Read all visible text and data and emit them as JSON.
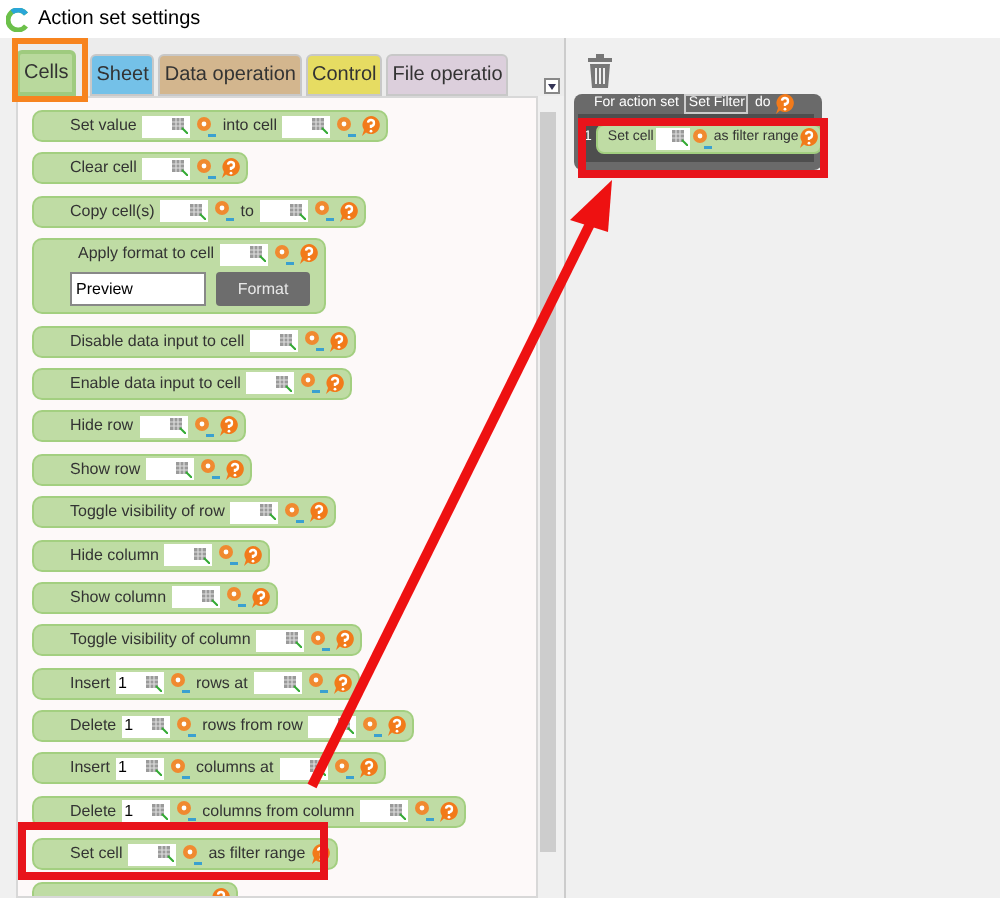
{
  "window": {
    "title": "Action set settings"
  },
  "tabs": [
    {
      "label": "Cells",
      "selected": true,
      "color": "#b9d99d"
    },
    {
      "label": "Sheet",
      "selected": false,
      "color": "#74c1e8"
    },
    {
      "label": "Data operation",
      "selected": false,
      "color": "#d3b68e"
    },
    {
      "label": "Control",
      "selected": false,
      "color": "#e6dc62"
    },
    {
      "label": "File operatio",
      "selected": false,
      "color": "#dccfdc"
    }
  ],
  "palette": [
    {
      "kind": "line",
      "parts": [
        {
          "kind": "text",
          "text": "Set value"
        },
        {
          "kind": "field"
        },
        {
          "kind": "text",
          "text": "into cell"
        },
        {
          "kind": "field"
        }
      ]
    },
    {
      "kind": "line",
      "parts": [
        {
          "kind": "text",
          "text": "Clear cell"
        },
        {
          "kind": "field"
        }
      ]
    },
    {
      "kind": "line",
      "parts": [
        {
          "kind": "text",
          "text": "Copy cell(s)"
        },
        {
          "kind": "field"
        },
        {
          "kind": "text",
          "text": "to"
        },
        {
          "kind": "field"
        }
      ]
    },
    {
      "kind": "format",
      "parts": [
        {
          "kind": "text",
          "text": "Apply format to cell"
        },
        {
          "kind": "field"
        }
      ],
      "preview": "Preview",
      "button": "Format"
    },
    {
      "kind": "line",
      "parts": [
        {
          "kind": "text",
          "text": "Disable data input to cell"
        },
        {
          "kind": "field"
        }
      ]
    },
    {
      "kind": "line",
      "parts": [
        {
          "kind": "text",
          "text": "Enable data input to cell"
        },
        {
          "kind": "field"
        }
      ]
    },
    {
      "kind": "line",
      "parts": [
        {
          "kind": "text",
          "text": "Hide row"
        },
        {
          "kind": "field"
        }
      ]
    },
    {
      "kind": "line",
      "parts": [
        {
          "kind": "text",
          "text": "Show row"
        },
        {
          "kind": "field"
        }
      ]
    },
    {
      "kind": "line",
      "parts": [
        {
          "kind": "text",
          "text": "Toggle visibility of row"
        },
        {
          "kind": "field"
        }
      ]
    },
    {
      "kind": "line",
      "parts": [
        {
          "kind": "text",
          "text": "Hide column"
        },
        {
          "kind": "field"
        }
      ]
    },
    {
      "kind": "line",
      "parts": [
        {
          "kind": "text",
          "text": "Show column"
        },
        {
          "kind": "field"
        }
      ]
    },
    {
      "kind": "line",
      "parts": [
        {
          "kind": "text",
          "text": "Toggle visibility of column"
        },
        {
          "kind": "field"
        }
      ]
    },
    {
      "kind": "line",
      "parts": [
        {
          "kind": "text",
          "text": "Insert"
        },
        {
          "kind": "field",
          "value": "1"
        },
        {
          "kind": "text",
          "text": "rows at"
        },
        {
          "kind": "field"
        }
      ]
    },
    {
      "kind": "line",
      "parts": [
        {
          "kind": "text",
          "text": "Delete"
        },
        {
          "kind": "field",
          "value": "1"
        },
        {
          "kind": "text",
          "text": "rows from row"
        },
        {
          "kind": "field"
        }
      ]
    },
    {
      "kind": "line",
      "parts": [
        {
          "kind": "text",
          "text": "Insert"
        },
        {
          "kind": "field",
          "value": "1"
        },
        {
          "kind": "text",
          "text": "columns at"
        },
        {
          "kind": "field"
        }
      ]
    },
    {
      "kind": "line",
      "parts": [
        {
          "kind": "text",
          "text": "Delete"
        },
        {
          "kind": "field",
          "value": "1"
        },
        {
          "kind": "text",
          "text": "columns from column"
        },
        {
          "kind": "field"
        }
      ]
    },
    {
      "kind": "line",
      "parts": [
        {
          "kind": "text",
          "text": "Set cell"
        },
        {
          "kind": "field"
        },
        {
          "kind": "text",
          "text": "as filter range"
        }
      ]
    },
    {
      "kind": "cut"
    }
  ],
  "action_set": {
    "header": [
      {
        "kind": "text",
        "text": "For action set"
      },
      {
        "kind": "name",
        "text": "Set Filter"
      },
      {
        "kind": "text",
        "text": "do"
      }
    ],
    "steps": [
      {
        "number": "1",
        "parts": [
          {
            "kind": "text",
            "text": "Set cell"
          },
          {
            "kind": "field"
          },
          {
            "kind": "text",
            "text": "as filter range"
          }
        ]
      }
    ]
  }
}
